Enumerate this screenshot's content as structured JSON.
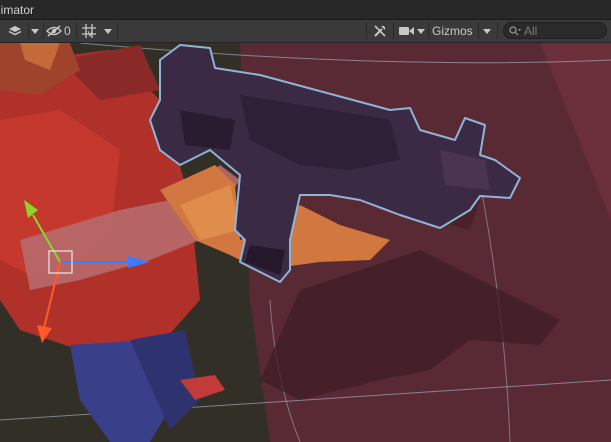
{
  "window": {
    "title": "nimator"
  },
  "toolbar": {
    "visibility_count": "0",
    "gizmos_label": "Gizmos",
    "search_placeholder": "All"
  },
  "icons": [
    "layers-icon",
    "dropdown-arrow-icon",
    "eye-slash-icon",
    "grid-icon",
    "tools-icon",
    "camera-icon",
    "search-icon"
  ],
  "colors": {
    "toolbar_bg": "#3a3a3a",
    "selection_outline": "#8fb4d8",
    "gizmo_x": "#3b7bff",
    "gizmo_y": "#8bd62a",
    "gizmo_z": "#ff5a2a"
  }
}
